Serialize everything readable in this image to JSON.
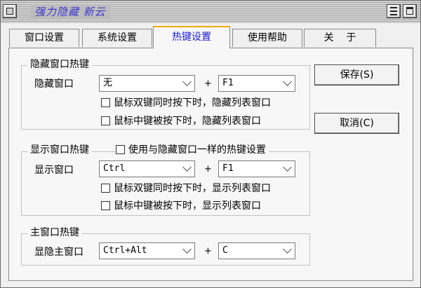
{
  "window": {
    "title": "强力隐藏 新云"
  },
  "tabs": [
    {
      "label": "窗口设置",
      "active": false
    },
    {
      "label": "系统设置",
      "active": false
    },
    {
      "label": "热键设置",
      "active": true
    },
    {
      "label": "使用帮助",
      "active": false
    },
    {
      "label": "关    于",
      "active": false
    }
  ],
  "hide_group": {
    "title": "隐藏窗口热键",
    "row_label": "隐藏窗口",
    "modifier": "无",
    "plus": "+",
    "key": "F1",
    "options": [
      {
        "label": "鼠标双键同时按下时，隐藏列表窗口",
        "checked": false
      },
      {
        "label": "鼠标中键被按下时，隐藏列表窗口",
        "checked": false
      }
    ]
  },
  "show_group": {
    "title": "显示窗口热键",
    "same_as_hide_label": "使用与隐藏窗口一样的热键设置",
    "row_label": "显示窗口",
    "modifier": "Ctrl",
    "plus": "+",
    "key": "F1",
    "options": [
      {
        "label": "鼠标双键同时按下时，显示列表窗口",
        "checked": false
      },
      {
        "label": "鼠标中键被按下时，显示列表窗口",
        "checked": false
      }
    ]
  },
  "main_group": {
    "title": "主窗口热键",
    "row_label": "显隐主窗口",
    "modifier": "Ctrl+Alt",
    "plus": "+",
    "key": "C"
  },
  "buttons": {
    "save": "保存(S)",
    "cancel": "取消(C)"
  }
}
